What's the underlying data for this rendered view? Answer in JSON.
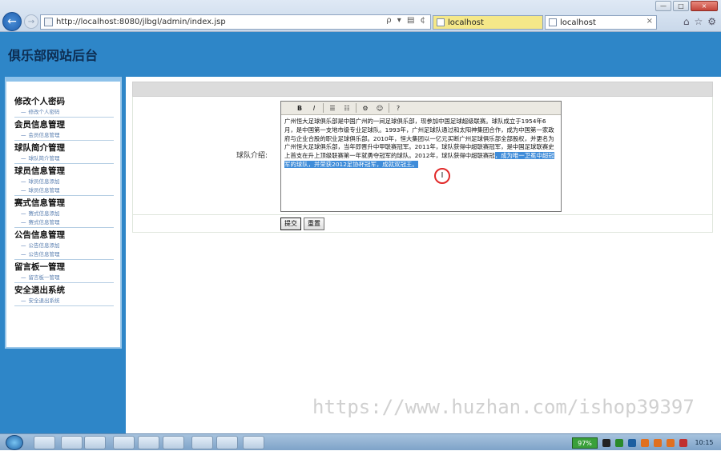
{
  "browser": {
    "url": "http://localhost:8080/jlbgl/admin/index.jsp",
    "address_tools": "ρ ▾ ▤ ¢",
    "tabs": [
      {
        "label": "localhost",
        "active": true
      },
      {
        "label": "localhost",
        "active": false
      }
    ],
    "tab_close": "×",
    "window_controls": {
      "minimize": "—",
      "maximize": "□",
      "close": "×"
    }
  },
  "app": {
    "title": "俱乐部网站后台"
  },
  "sidebar": {
    "groups": [
      {
        "title": "修改个人密码",
        "items": [
          "修改个人密码"
        ]
      },
      {
        "title": "会员信息管理",
        "items": [
          "会员信息管理"
        ]
      },
      {
        "title": "球队简介管理",
        "items": [
          "球队简介管理"
        ]
      },
      {
        "title": "球员信息管理",
        "items": [
          "球员信息添加",
          "球员信息管理"
        ]
      },
      {
        "title": "赛式信息管理",
        "items": [
          "赛式信息添加",
          "赛式信息管理"
        ]
      },
      {
        "title": "公告信息管理",
        "items": [
          "公告信息添加",
          "公告信息管理"
        ]
      },
      {
        "title": "留言板一管理",
        "items": [
          "留言板一管理"
        ]
      },
      {
        "title": "安全退出系统",
        "items": [
          "安全退出系统"
        ]
      }
    ],
    "item_prefix": "—"
  },
  "form": {
    "intro_label": "球队介绍:",
    "editor_toolbar": [
      "B",
      "I",
      "☰",
      "☷",
      "⚙",
      "☺",
      "?"
    ],
    "editor_text_plain": "广州恒大足球俱乐部是中国广州的一间足球俱乐部，现参加中国足球超级联赛。球队成立于1954年6月，是中国第一支地市级专业足球队。1993年，广州足球队通过和太阳神集团合作，成为中国第一家政府与企业合股的职业足球俱乐部。2010年，恒大集团以一亿元买断广州足球俱乐部全部股权，并更名为广州恒大足球俱乐部，当年即晋升中甲联赛冠军。2011年，球队获得中超联赛冠军，是中国足球联赛史上首支在升上顶级联赛第一年就勇夺冠军的球队。2012年，球队获得中超联赛冠",
    "editor_text_selected": "，成为唯一卫冕中超冠军的球队，并荣获2012足协杯冠军，成就双冠王。",
    "submit_label": "提交",
    "reset_label": "重置"
  },
  "watermark": "https://www.huzhan.com/ishop39397",
  "taskbar": {
    "battery": "97%",
    "clock": "10:15"
  },
  "colors": {
    "header_blue": "#2e86c8",
    "selection": "#3f8cd9",
    "cursor_ring": "#e12a2a"
  }
}
